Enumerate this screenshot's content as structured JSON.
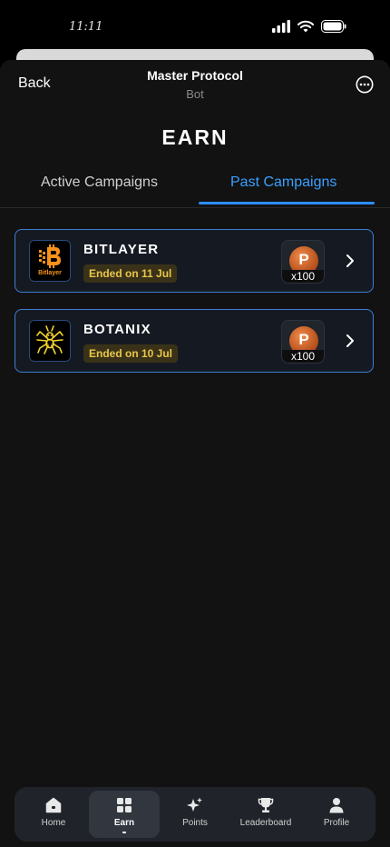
{
  "status_bar": {
    "time": "11:11",
    "icons": [
      "cellular-icon",
      "wifi-icon",
      "battery-icon"
    ]
  },
  "header": {
    "back_label": "Back",
    "title": "Master Protocol",
    "subtitle": "Bot",
    "more_icon": "more-icon"
  },
  "page": {
    "title": "EARN"
  },
  "tabs": [
    {
      "label": "Active Campaigns",
      "active": false
    },
    {
      "label": "Past Campaigns",
      "active": true
    }
  ],
  "campaigns": [
    {
      "name": "BITLAYER",
      "status": "Ended on 11 Jul",
      "logo_icon": "bitlayer-logo-icon",
      "logo_text": "Bitlayer",
      "reward_letter": "P",
      "reward_qty": "x100"
    },
    {
      "name": "BOTANIX",
      "status": "Ended on 10 Jul",
      "logo_icon": "botanix-logo-icon",
      "reward_letter": "P",
      "reward_qty": "x100"
    }
  ],
  "tabbar": [
    {
      "label": "Home",
      "icon": "home-icon",
      "active": false
    },
    {
      "label": "Earn",
      "icon": "grid-icon",
      "active": true
    },
    {
      "label": "Points",
      "icon": "sparkle-icon",
      "active": false
    },
    {
      "label": "Leaderboard",
      "icon": "trophy-icon",
      "active": false
    },
    {
      "label": "Profile",
      "icon": "person-icon",
      "active": false
    }
  ],
  "colors": {
    "accent": "#2d8cff",
    "card_border": "#3b7fd4",
    "ended_badge_text": "#e9c64a",
    "bitlayer_orange": "#f7931a",
    "botanix_yellow": "#f5d52a"
  }
}
